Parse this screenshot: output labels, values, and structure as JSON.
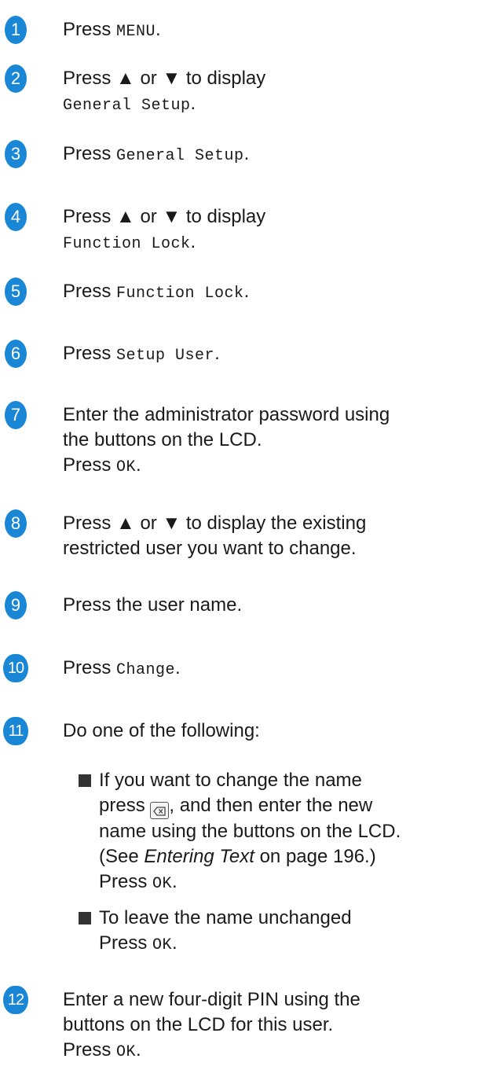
{
  "steps": {
    "s1": {
      "num": "1",
      "press": "Press",
      "code": "MENU",
      "end": "."
    },
    "s2": {
      "num": "2",
      "line1": "Press ▲ or ▼ to display",
      "code": "General Setup",
      "end": "."
    },
    "s3": {
      "num": "3",
      "press": "Press",
      "code": "General Setup",
      "end": "."
    },
    "s4": {
      "num": "4",
      "line1": "Press ▲ or ▼ to display",
      "code": "Function Lock",
      "end": "."
    },
    "s5": {
      "num": "5",
      "press": "Press",
      "code": "Function Lock",
      "end": "."
    },
    "s6": {
      "num": "6",
      "press": "Press",
      "code": "Setup User",
      "end": "."
    },
    "s7": {
      "num": "7",
      "line1": "Enter the administrator password using",
      "line2": "the buttons on the LCD.",
      "press": "Press",
      "code": "OK",
      "end": "."
    },
    "s8": {
      "num": "8",
      "line1": "Press ▲ or ▼ to display the existing",
      "line2": "restricted user you want to change."
    },
    "s9": {
      "num": "9",
      "line1": "Press the user name."
    },
    "s10": {
      "num": "10",
      "press": "Press",
      "code": "Change",
      "end": "."
    },
    "s11": {
      "num": "11",
      "line1": "Do one of the following:",
      "opt1": {
        "line1": "If you want to change the name",
        "press": "press",
        "after_icon": ", and then enter the new",
        "line3": "name using the buttons on the LCD.",
        "see": "(See",
        "link": "Entering Text",
        "see_end": "on page 196.)",
        "press2": "Press",
        "code": "OK",
        "end": "."
      },
      "opt2": {
        "line1": "To leave the name unchanged",
        "press": "Press",
        "code": "OK",
        "end": "."
      }
    },
    "s12": {
      "num": "12",
      "line1": "Enter a new four-digit PIN using the",
      "line2": "buttons on the LCD for this user.",
      "press": "Press",
      "code": "OK",
      "end": "."
    }
  },
  "icons": {
    "backspace": "backspace-key-icon"
  },
  "colors": {
    "step_badge": "#1a86d6",
    "text": "#1a1a1a",
    "bullet": "#333333"
  }
}
